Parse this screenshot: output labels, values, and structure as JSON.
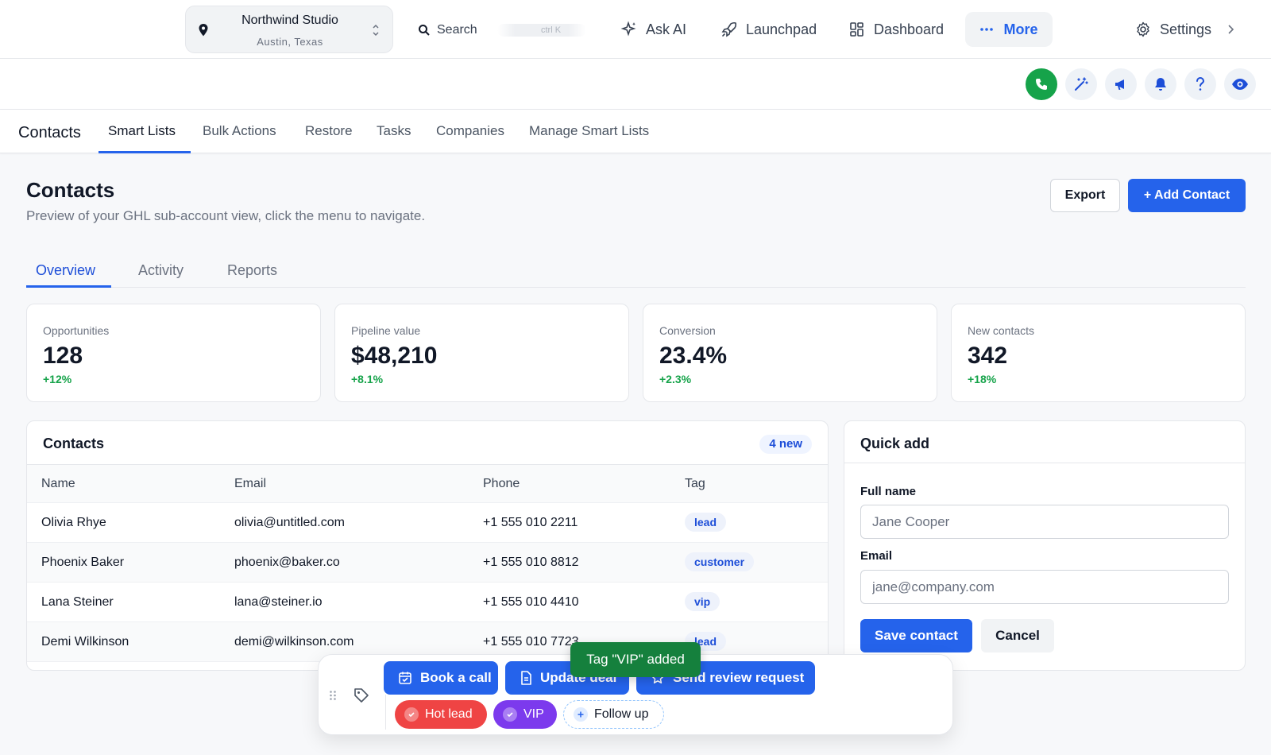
{
  "location": {
    "name": "Northwind Studio",
    "sub": "Austin, Texas"
  },
  "search": {
    "label": "Search",
    "shortcut": "ctrl K"
  },
  "nav": {
    "ask_ai": "Ask AI",
    "launchpad": "Launchpad",
    "dashboard": "Dashboard",
    "more": "More",
    "settings": "Settings"
  },
  "subnav": {
    "title": "Contacts",
    "tabs": [
      "Smart Lists",
      "Bulk Actions",
      "Restore",
      "Tasks",
      "Companies",
      "Manage Smart Lists"
    ]
  },
  "page": {
    "title": "Contacts",
    "subtitle": "Preview of your GHL sub-account view, click the menu to navigate.",
    "export": "Export",
    "add": "+ Add Contact"
  },
  "tabs": [
    "Overview",
    "Activity",
    "Reports"
  ],
  "stats": [
    {
      "label": "Opportunities",
      "value": "128",
      "delta": "+12%"
    },
    {
      "label": "Pipeline value",
      "value": "$48,210",
      "delta": "+8.1%"
    },
    {
      "label": "Conversion",
      "value": "23.4%",
      "delta": "+2.3%"
    },
    {
      "label": "New contacts",
      "value": "342",
      "delta": "+18%"
    }
  ],
  "contacts": {
    "title": "Contacts",
    "badge": "4 new",
    "columns": [
      "Name",
      "Email",
      "Phone",
      "Tag"
    ],
    "rows": [
      {
        "name": "Olivia Rhye",
        "email": "olivia@untitled.com",
        "phone": "+1 555 010 2211",
        "tag": "lead"
      },
      {
        "name": "Phoenix Baker",
        "email": "phoenix@baker.co",
        "phone": "+1 555 010 8812",
        "tag": "customer"
      },
      {
        "name": "Lana Steiner",
        "email": "lana@steiner.io",
        "phone": "+1 555 010 4410",
        "tag": "vip"
      },
      {
        "name": "Demi Wilkinson",
        "email": "demi@wilkinson.com",
        "phone": "+1 555 010 7723",
        "tag": "lead"
      }
    ]
  },
  "quick_add": {
    "title": "Quick add",
    "full_name_label": "Full name",
    "full_name_placeholder": "Jane Cooper",
    "email_label": "Email",
    "email_placeholder": "jane@company.com",
    "save": "Save contact",
    "cancel": "Cancel"
  },
  "floatbar": {
    "actions": [
      "Book a call",
      "Update deal",
      "Send review request"
    ],
    "chips": [
      "Hot lead",
      "VIP",
      "Follow up"
    ]
  },
  "toast": "Tag \"VIP\" added",
  "colors": {
    "accent": "#2563eb",
    "success": "#16a34a",
    "danger": "#ef4444",
    "purple": "#7c3aed"
  }
}
